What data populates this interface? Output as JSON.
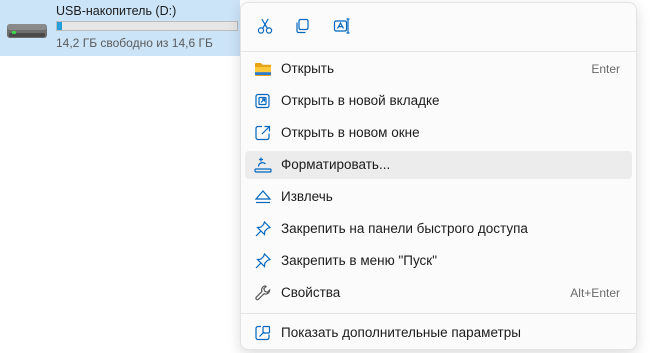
{
  "drive": {
    "name": "USB-накопитель (D:)",
    "info": "14,2 ГБ свободно из 14,6 ГБ",
    "used_fraction": 0.027
  },
  "toolbar": {
    "cut": "cut-icon",
    "copy": "copy-icon",
    "rename": "rename-icon"
  },
  "menu": {
    "items": [
      {
        "label": "Открыть",
        "accelerator": "Enter",
        "icon": "folder-icon"
      },
      {
        "label": "Открыть в новой вкладке",
        "accelerator": "",
        "icon": "open-new-tab-icon"
      },
      {
        "label": "Открыть в новом окне",
        "accelerator": "",
        "icon": "open-new-window-icon"
      },
      {
        "label": "Форматировать...",
        "accelerator": "",
        "icon": "format-icon"
      },
      {
        "label": "Извлечь",
        "accelerator": "",
        "icon": "eject-icon"
      },
      {
        "label": "Закрепить на панели быстрого доступа",
        "accelerator": "",
        "icon": "pin-icon"
      },
      {
        "label": "Закрепить в меню \"Пуск\"",
        "accelerator": "",
        "icon": "pin-icon"
      },
      {
        "label": "Свойства",
        "accelerator": "Alt+Enter",
        "icon": "wrench-icon"
      },
      {
        "label": "Показать дополнительные параметры",
        "accelerator": "",
        "icon": "show-more-icon"
      }
    ]
  },
  "colors": {
    "accent": "#0067c0",
    "selection": "#cce4f7",
    "hover": "#ececec",
    "storage_bar": "#26a0da"
  }
}
